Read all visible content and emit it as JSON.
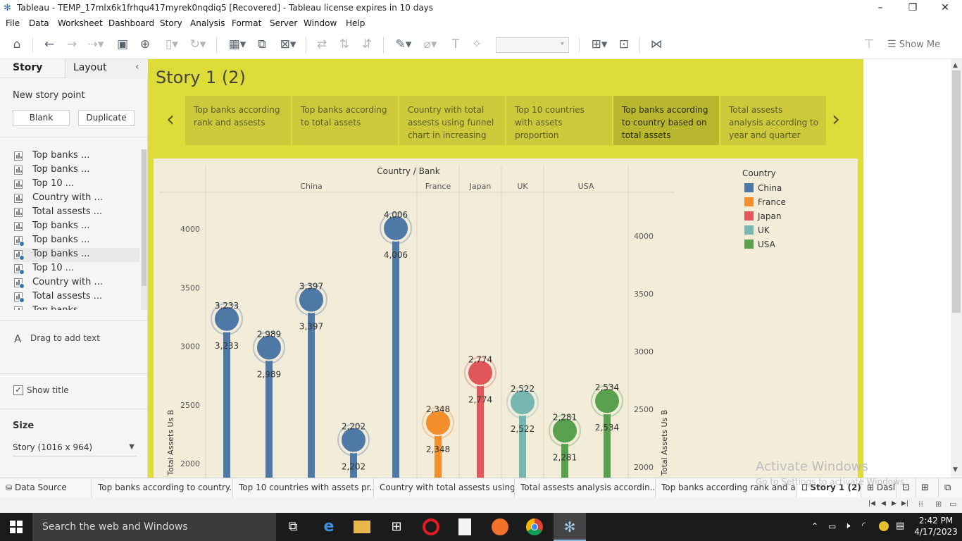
{
  "window": {
    "title": "Tableau - TEMP_17mlx6k1frhqu417myrek0nqdiq5 [Recovered] - Tableau license expires in 10 days"
  },
  "menu": [
    "File",
    "Data",
    "Worksheet",
    "Dashboard",
    "Story",
    "Analysis",
    "Format",
    "Server",
    "Window",
    "Help"
  ],
  "toolbar": {
    "show_me": "Show Me"
  },
  "left_pane": {
    "tabs": [
      "Story",
      "Layout"
    ],
    "new_story_point": "New story point",
    "blank_button": "Blank",
    "duplicate_button": "Duplicate",
    "sheets": [
      {
        "label": "Top banks ...",
        "checked": false
      },
      {
        "label": "Top banks ...",
        "checked": false
      },
      {
        "label": "Top 10 ...",
        "checked": false
      },
      {
        "label": "Country with ...",
        "checked": false
      },
      {
        "label": "Total assests ...",
        "checked": false
      },
      {
        "label": "Top banks ...",
        "checked": false
      },
      {
        "label": "Top banks ...",
        "checked": true
      },
      {
        "label": "Top banks ...",
        "checked": true
      },
      {
        "label": "Top 10 ...",
        "checked": true
      },
      {
        "label": "Country with ...",
        "checked": true
      },
      {
        "label": "Total assests ...",
        "checked": true
      },
      {
        "label": "Top banks ...",
        "checked": false
      }
    ],
    "drag_text": "Drag to add text",
    "show_title": "Show title",
    "size_label": "Size",
    "size_value": "Story (1016 x 964)"
  },
  "story": {
    "title": "Story 1 (2)",
    "points": [
      "Top banks according rank and assests",
      "Top banks according to total assets",
      "Country with total assests using funnel chart in increasing",
      "Top 10 countries with assets proportion",
      "Top banks according to country based on total assets",
      "Total assests analysis according to year and quarter"
    ],
    "active_point": 4
  },
  "chart_data": {
    "type": "lollipop",
    "header_title": "Country / Bank",
    "country_headers": [
      "China",
      "France",
      "Japan",
      "UK",
      "USA"
    ],
    "legend_title": "Country",
    "legend": [
      {
        "name": "China",
        "color": "#4e79a7"
      },
      {
        "name": "France",
        "color": "#f28e2b"
      },
      {
        "name": "Japan",
        "color": "#e15759"
      },
      {
        "name": "UK",
        "color": "#76b7b2"
      },
      {
        "name": "USA",
        "color": "#59a14f"
      }
    ],
    "ylabel": "Total Assets Us B",
    "ylabel_right": "Total Assets Us B",
    "left_ticks": [
      2000,
      2500,
      3000,
      3500,
      4000
    ],
    "right_ticks": [
      2000,
      2500,
      3000,
      3500,
      4000
    ],
    "points": [
      {
        "country": "China",
        "value": 3233,
        "label": "3,233"
      },
      {
        "country": "China",
        "value": 2989,
        "label": "2,989"
      },
      {
        "country": "China",
        "value": 3397,
        "label": "3,397"
      },
      {
        "country": "China",
        "value": 2202,
        "label": "2,202"
      },
      {
        "country": "China",
        "value": 4006,
        "label": "4,006"
      },
      {
        "country": "France",
        "value": 2348,
        "label": "2,348"
      },
      {
        "country": "Japan",
        "value": 2774,
        "label": "2,774"
      },
      {
        "country": "UK",
        "value": 2522,
        "label": "2,522"
      },
      {
        "country": "USA",
        "value": 2281,
        "label": "2,281"
      },
      {
        "country": "USA",
        "value": 2534,
        "label": "2,534"
      }
    ]
  },
  "bottom_tabs": [
    "Data Source",
    "Top banks according to country...",
    "Top 10 countries with assets pr...",
    "Country with total assests using...",
    "Total assests analysis accordin...",
    "Top banks according rank and a...",
    "Story 1 (2)",
    "Dasl"
  ],
  "watermark": {
    "line1": "Activate Windows",
    "line2": "Go to Settings to activate Windows."
  },
  "taskbar": {
    "search": "Search the web and Windows",
    "time": "2:42 PM",
    "date": "4/17/2023"
  }
}
